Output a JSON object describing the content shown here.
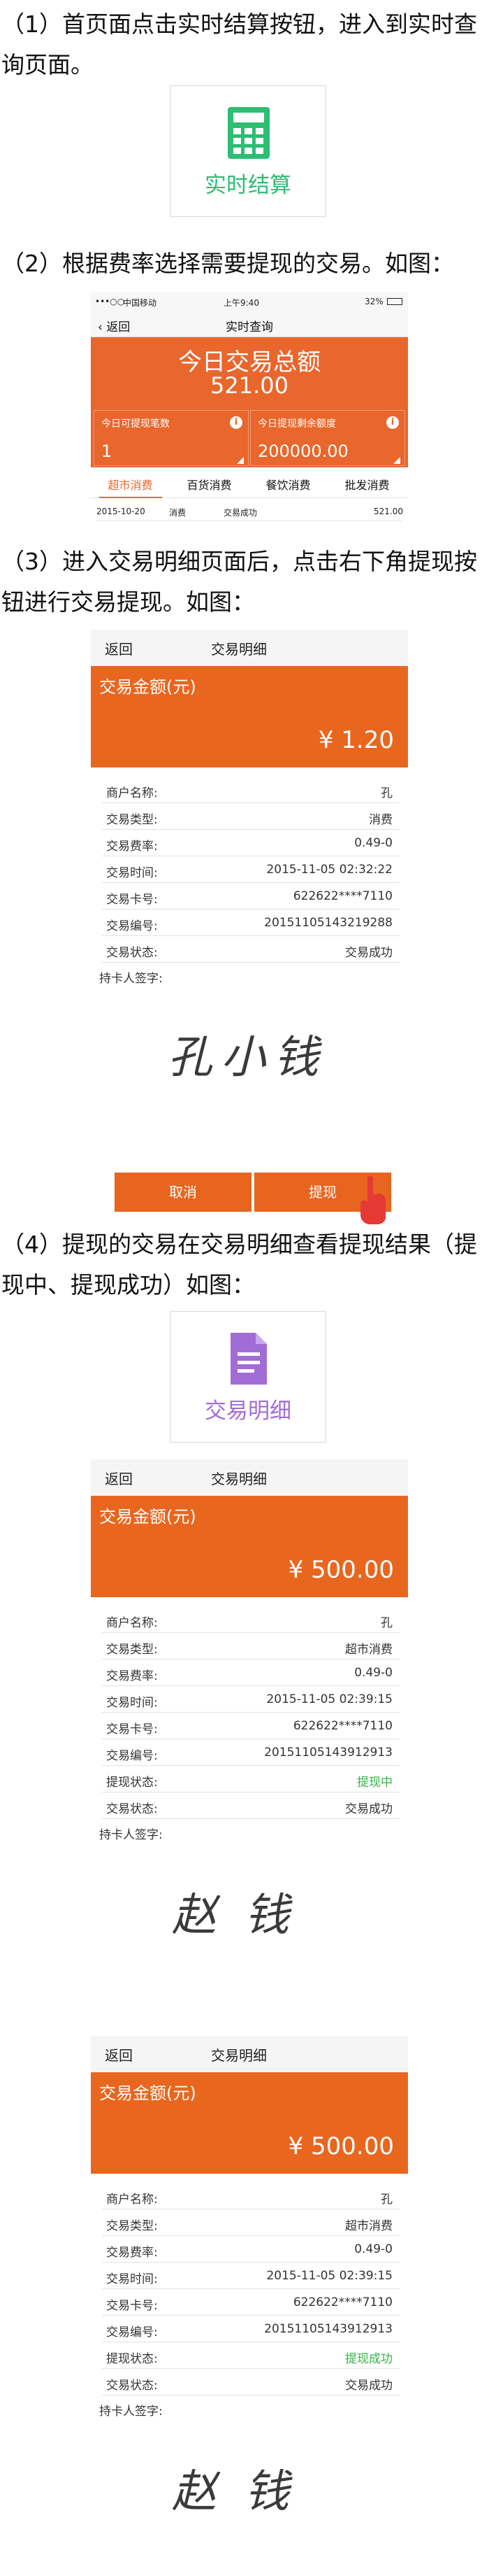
{
  "steps": [
    "（1）首页面点击实时结算按钮，进入到实时查询页面。",
    "（2）根据费率选择需要提现的交易。如图：",
    "（3）进入交易明细页面后，点击右下角提现按钮进行交易提现。如图：",
    "（4）提现的交易在交易明细查看提现结果（提现中、提现成功）如图："
  ],
  "feature_buttons": {
    "realtime": {
      "label": "实时结算",
      "icon": "calculator-icon",
      "color": "#2dbd73"
    },
    "detail": {
      "label": "交易明细",
      "icon": "document-icon",
      "color": "#a26cd6"
    }
  },
  "query_screen": {
    "status": {
      "carrier": "中国移动",
      "time": "上午9:40",
      "battery": "32%"
    },
    "back_label": "返回",
    "title": "实时查询",
    "total_label": "今日交易总额",
    "total_value": "521.00",
    "withdrawable_count_label": "今日可提现笔数",
    "withdrawable_count": "1",
    "remaining_limit_label": "今日提现剩余额度",
    "remaining_limit": "200000.00",
    "info_glyph": "i",
    "tabs": [
      "超市消费",
      "百货消费",
      "餐饮消费",
      "批发消费"
    ],
    "active_tab": 0,
    "record": {
      "date": "2015-10-20",
      "type": "消费",
      "status": "交易成功",
      "amount": "521.00"
    }
  },
  "detail_labels": {
    "back": "返回",
    "title": "交易明细",
    "amount_label": "交易金额(元)",
    "signature_label": "持卡人签字:",
    "fields": [
      "商户名称:",
      "交易类型:",
      "交易费率:",
      "交易时间:",
      "交易卡号:",
      "交易编号:",
      "提现状态:",
      "交易状态:"
    ]
  },
  "detail_screen_1": {
    "amount": "¥ 1.20",
    "values": [
      "孔",
      "消费",
      "0.49-0",
      "2015-11-05 02:32:22",
      "622622****7110",
      "20151105143219288",
      "",
      "交易成功"
    ],
    "signature": "孔小钱",
    "cancel_label": "取消",
    "withdraw_label": "提现"
  },
  "detail_screen_2": {
    "amount": "¥ 500.00",
    "values": [
      "孔",
      "超市消费",
      "0.49-0",
      "2015-11-05 02:39:15",
      "622622****7110",
      "20151105143912913",
      "提现中",
      "交易成功"
    ],
    "signature": "赵钱"
  },
  "detail_screen_3": {
    "amount": "¥ 500.00",
    "values": [
      "孔",
      "超市消费",
      "0.49-0",
      "2015-11-05 02:39:15",
      "622622****7110",
      "20151105143912913",
      "提现成功",
      "交易成功"
    ],
    "signature": "赵钱"
  },
  "colors": {
    "accent": "#e9662c",
    "success": "#36b34a"
  }
}
